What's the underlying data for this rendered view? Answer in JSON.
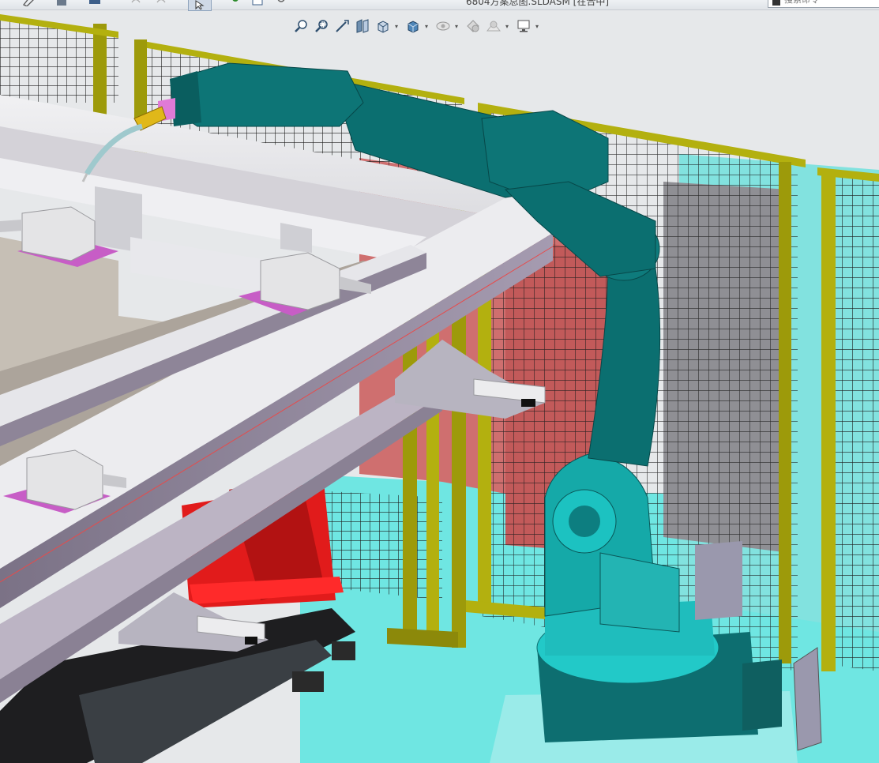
{
  "window": {
    "document_title": "6804方案总图.SLDASM [在合中]",
    "search_placeholder": "搜索命令"
  },
  "toolbar_top": {
    "icons": [
      "sketch-icon",
      "save-icon",
      "print-icon",
      "undo-icon",
      "redo-icon",
      "select-icon",
      "rebuild-icon",
      "file-properties-icon",
      "options-icon"
    ]
  },
  "heads_up_toolbar": {
    "icons": [
      "zoom-to-fit-icon",
      "zoom-to-area-icon",
      "previous-view-icon",
      "section-view-icon",
      "view-orientation-icon",
      "display-style-icon",
      "hide-show-items-icon",
      "edit-appearance-icon",
      "apply-scene-icon",
      "view-settings-icon"
    ]
  },
  "scene": {
    "description_colors": {
      "background": "#e4e7ea",
      "floor": "#6fe6e2",
      "fence_post": "#9d9a0a",
      "robot": "#0b6f70",
      "robot_base": "#22c9c8",
      "frame": "#e6e6ea",
      "carriage": "#e4e4e6",
      "pad": "#c75dc6",
      "stand": "#e11b1b",
      "wall": "#cf6f6f"
    }
  }
}
